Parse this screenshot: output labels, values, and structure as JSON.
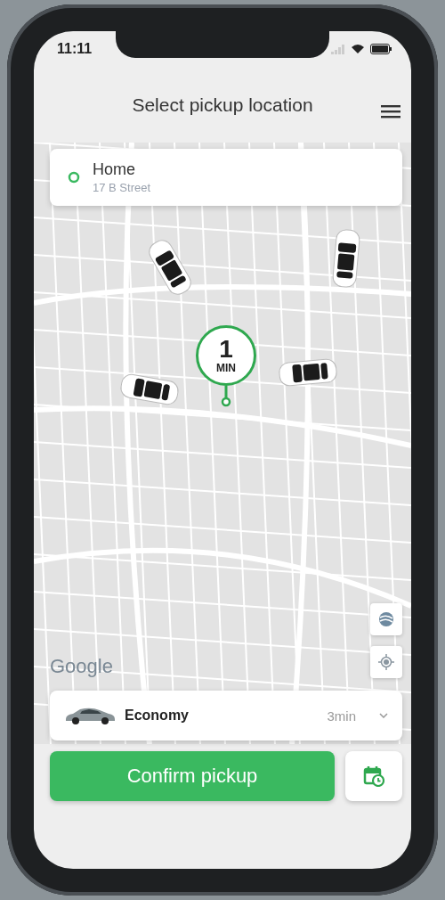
{
  "status_bar": {
    "time": "11:11"
  },
  "header": {
    "title": "Select pickup location"
  },
  "pickup": {
    "name": "Home",
    "address": "17 B Street"
  },
  "map": {
    "eta_value": "1",
    "eta_unit": "MIN",
    "attribution": "Google"
  },
  "ride": {
    "name": "Economy",
    "eta": "3min"
  },
  "confirm_button": "Confirm pickup"
}
